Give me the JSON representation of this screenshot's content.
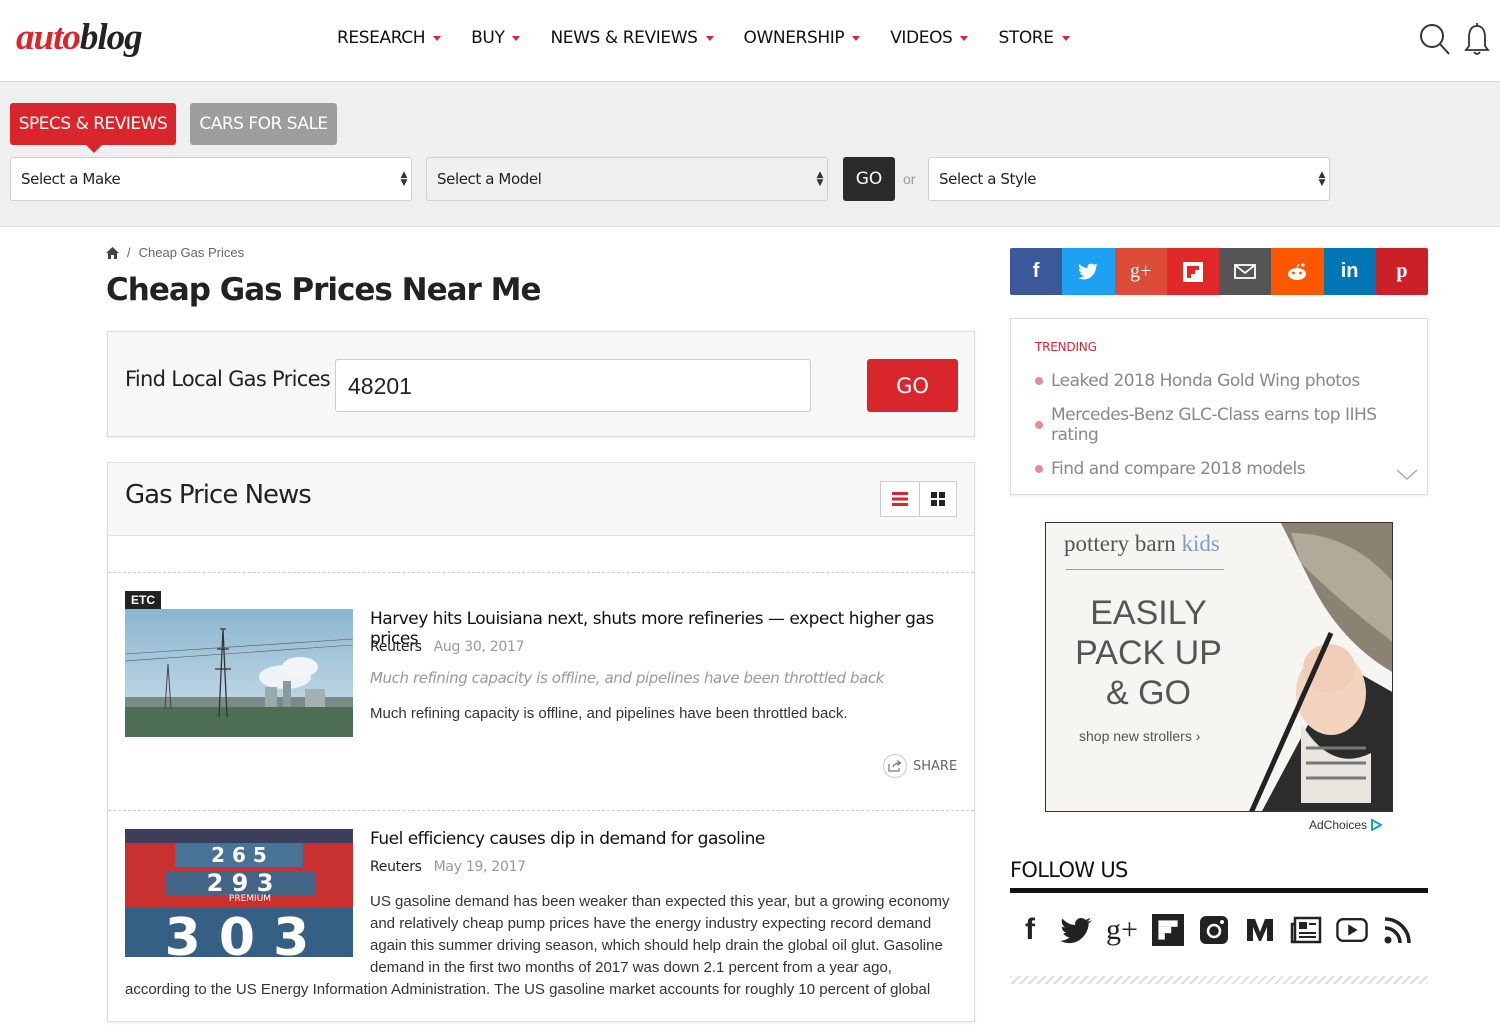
{
  "header": {
    "logo_left": "auto",
    "logo_right": "blog",
    "nav": [
      "RESEARCH",
      "BUY",
      "NEWS & REVIEWS",
      "OWNERSHIP",
      "VIDEOS",
      "STORE"
    ]
  },
  "finder": {
    "tab_specs": "SPECS & REVIEWS",
    "tab_cars": "CARS FOR SALE",
    "make": "Select a Make",
    "model": "Select a Model",
    "go": "GO",
    "or": "or",
    "style": "Select a Style"
  },
  "breadcrumb": {
    "sep": "/",
    "current": "Cheap Gas Prices"
  },
  "page_title": "Cheap Gas Prices Near Me",
  "gas_search": {
    "label": "Find Local Gas Prices",
    "zip": "48201",
    "go": "GO"
  },
  "news": {
    "title": "Gas Price News",
    "articles": [
      {
        "badge": "ETC",
        "title": "Harvey hits Louisiana next, shuts more refineries — expect higher gas prices",
        "source": "Reuters",
        "date": "Aug 30, 2017",
        "dek": "Much refining capacity is offline, and pipelines have been throttled back",
        "body": "Much refining capacity is offline, and pipelines have been throttled back.",
        "share": "SHARE"
      },
      {
        "title": "Fuel efficiency causes dip in demand for gasoline",
        "source": "Reuters",
        "date": "May 19, 2017",
        "body_wrap": "US gasoline demand has been weaker than expected this year, but a growing economy and relatively cheap pump prices have the energy industry expecting record demand again this summer driving season, which should help drain the global oil glut. Gasoline demand in the first two months of 2017 was down 2.1 percent from a year ago,",
        "body_full": "according to the US Energy Information Administration. The US gasoline market accounts for roughly 10 percent of global"
      }
    ]
  },
  "sidebar": {
    "trending_label": "TRENDING",
    "trending": [
      "Leaked 2018 Honda Gold Wing photos",
      "Mercedes-Benz GLC-Class earns top IIHS rating",
      "Find and compare 2018 models"
    ],
    "ad": {
      "brand": "pottery barn",
      "brand_accent": "kids",
      "headline": "EASILY PACK UP & GO",
      "cta": "shop new strollers ›",
      "adchoices": "AdChoices"
    },
    "follow_label": "FOLLOW US"
  },
  "colors": {
    "accent": "#d8262c",
    "facebook": "#3b5998",
    "twitter": "#1da1f2",
    "gplus": "#dd4b39",
    "flipboard": "#e12828",
    "email": "#555555",
    "reddit": "#ff5700",
    "linkedin": "#0077b5",
    "pinterest": "#cb2027"
  }
}
